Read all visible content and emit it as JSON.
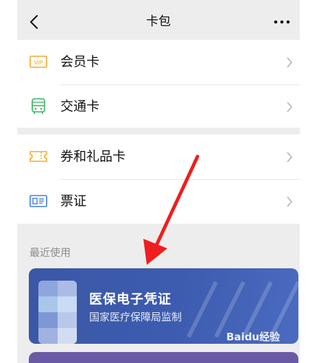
{
  "header": {
    "title": "卡包"
  },
  "group1": {
    "items": [
      {
        "label": "会员卡",
        "icon": "vip-card-icon",
        "color": "#f5a623"
      },
      {
        "label": "交通卡",
        "icon": "bus-icon",
        "color": "#2fb25c"
      }
    ]
  },
  "group2": {
    "items": [
      {
        "label": "券和礼品卡",
        "icon": "ticket-icon",
        "color": "#f5a623"
      },
      {
        "label": "票证",
        "icon": "id-card-icon",
        "color": "#3b7be0"
      }
    ]
  },
  "recent": {
    "section_label": "最近使用",
    "card": {
      "title": "医保电子凭证",
      "subtitle": "国家医疗保障局监制",
      "color": "#3d5cb0"
    }
  },
  "watermark": {
    "text": "Baidu经验"
  }
}
